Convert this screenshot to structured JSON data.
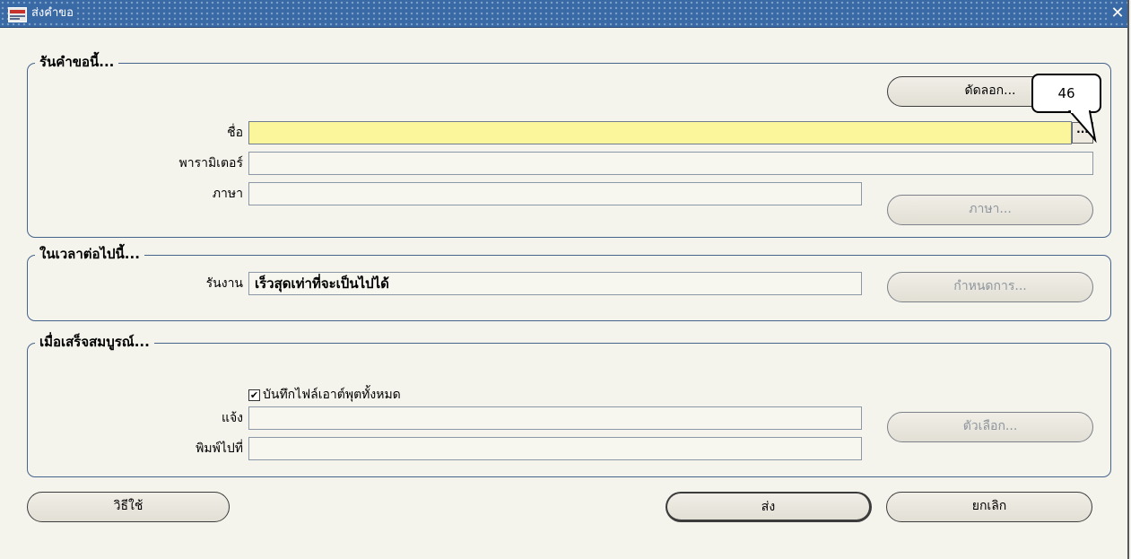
{
  "window": {
    "title": "ส่งคำขอ",
    "close_symbol": "✕"
  },
  "request_section": {
    "title": "รันคำขอนี้...",
    "copy_button": "ดัดลอก...",
    "name_label": "ชื่อ",
    "name_value": "",
    "lov_button": "...",
    "parameters_label": "พารามิเตอร์",
    "parameters_value": "",
    "language_label": "ภาษา",
    "language_value": "",
    "language_button": "ภาษา..."
  },
  "schedule_section": {
    "title": "ในเวลาต่อไปนี้...",
    "run_label": "รันงาน",
    "run_value": "เร็วสุดเท่าที่จะเป็นไปได้",
    "schedule_button": "กำหนดการ..."
  },
  "completion_section": {
    "title": "เมื่อเสร็จสมบูรณ์...",
    "save_output_label": "บันทึกไฟล์เอาต์พุตทั้งหมด",
    "save_output_checked": true,
    "notify_label": "แจ้ง",
    "notify_value": "",
    "print_label": "พิมพ์ไปที่",
    "print_value": "",
    "options_button": "ตัวเลือก..."
  },
  "footer": {
    "help_button": "วิธีใช้",
    "submit_button": "ส่ง",
    "cancel_button": "ยกเลิก"
  },
  "callout": {
    "text": "46"
  },
  "colors": {
    "titlebar": "#3a6aa6",
    "active_field": "#fbf59b",
    "frame": "#44648c",
    "background": "#f4f3ec"
  }
}
